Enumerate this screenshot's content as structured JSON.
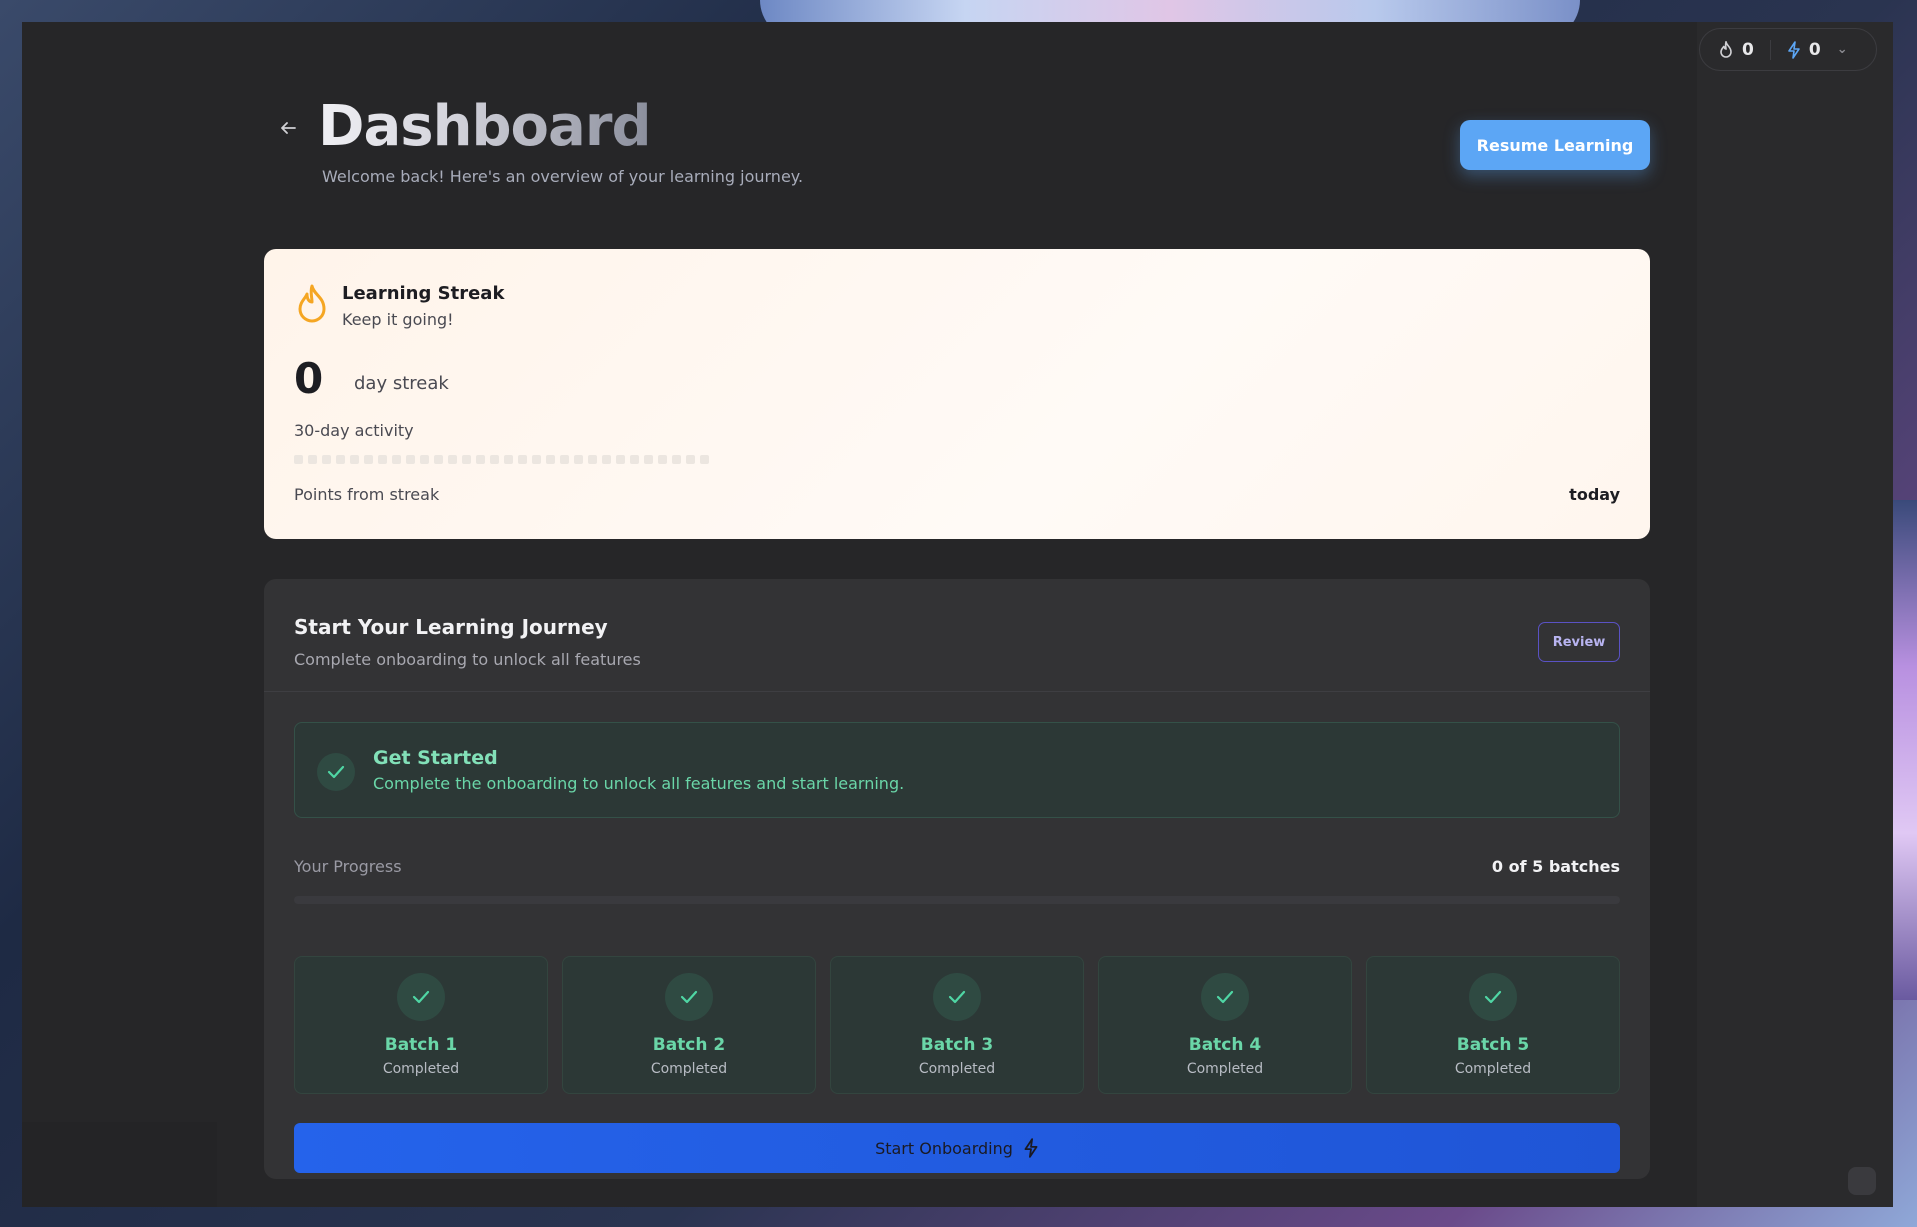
{
  "topbar": {
    "streak_count": "0",
    "points_count": "0"
  },
  "header": {
    "title": "Dashboard",
    "subtitle": "Welcome back! Here's an overview of your learning journey.",
    "resume_label": "Resume Learning"
  },
  "streak": {
    "title": "Learning Streak",
    "subtitle": "Keep it going!",
    "count": "0",
    "unit": "day streak",
    "activity_label": "30-day activity",
    "activity_days": 30,
    "points_label": "Points from streak",
    "points_value": "today"
  },
  "journey": {
    "title": "Start Your Learning Journey",
    "subtitle": "Complete onboarding to unlock all features",
    "review_label": "Review",
    "get_started": {
      "title": "Get Started",
      "description": "Complete the onboarding to unlock all features and start learning."
    },
    "progress_label": "Your Progress",
    "progress_value": "0 of 5 batches",
    "progress_fraction": 0,
    "batches": [
      {
        "name": "Batch 1",
        "status": "Completed"
      },
      {
        "name": "Batch 2",
        "status": "Completed"
      },
      {
        "name": "Batch 3",
        "status": "Completed"
      },
      {
        "name": "Batch 4",
        "status": "Completed"
      },
      {
        "name": "Batch 5",
        "status": "Completed"
      }
    ],
    "start_label": "Start Onboarding"
  },
  "icons": {
    "back": "arrow-left-icon",
    "flame": "flame-icon",
    "bolt": "bolt-icon",
    "check": "check-icon",
    "chevron": "chevron-down-icon"
  },
  "colors": {
    "accent": "#5ca6f5",
    "primary_button": "#2563eb",
    "success": "#4fd6a4",
    "streak_flame": "#f5a623"
  }
}
